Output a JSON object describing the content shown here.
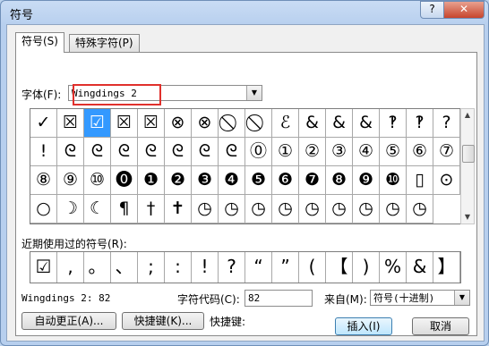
{
  "window": {
    "title": "符号"
  },
  "titlebar": {
    "help": "?",
    "close": "✕"
  },
  "tabs": [
    {
      "label": "符号(S)"
    },
    {
      "label": "特殊字符(P)"
    }
  ],
  "font": {
    "label": "字体(F):",
    "value": "Wingdings 2"
  },
  "symbols": [
    "✓",
    "☒",
    "☑",
    "☒",
    "☒",
    "⊗",
    "⊗",
    "⃠",
    "⃠",
    "ℰ",
    "&",
    "&",
    "&",
    "‽",
    "‽",
    "?",
    "!",
    "ᘓ",
    "ᘓ",
    "ᘓ",
    "ᘓ",
    "ᘓ",
    "ᘓ",
    "ᘓ",
    "⓪",
    "①",
    "②",
    "③",
    "④",
    "⑤",
    "⑥",
    "⑦",
    "⑧",
    "⑨",
    "⑩",
    "⓿",
    "❶",
    "❷",
    "❸",
    "❹",
    "❺",
    "❻",
    "❼",
    "❽",
    "❾",
    "❿",
    "▯",
    "⊙",
    "○",
    "☽",
    "☾",
    "¶",
    "†",
    "✝",
    "◷",
    "◷",
    "◷",
    "◷",
    "◷",
    "◷",
    "◷",
    "◷",
    "◷"
  ],
  "recent": {
    "label": "近期使用过的符号(R):",
    "items": [
      "☑",
      ",",
      "。",
      "、",
      ";",
      ":",
      "!",
      "?",
      "“",
      "”",
      "(",
      "【",
      ")",
      "%",
      "&",
      "】"
    ]
  },
  "info": {
    "charname": "Wingdings 2: 82",
    "code_label": "字符代码(C):",
    "code_value": "82",
    "from_label": "来自(M):",
    "from_value": "符号(十进制)"
  },
  "buttons": {
    "autocorrect": "自动更正(A)...",
    "shortcut_key": "快捷键(K)...",
    "shortcut_label": "快捷键:",
    "insert": "插入(I)",
    "cancel": "取消"
  }
}
